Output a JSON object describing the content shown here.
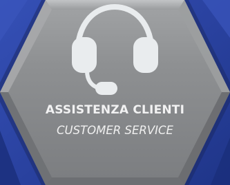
{
  "panel": {
    "icon": "headset-icon",
    "title": "ASSISTENZA CLIENTI",
    "subtitle": "CUSTOMER SERVICE"
  },
  "colors": {
    "background_blue": "#2a44a4",
    "hex_gray": "#8b8d8f",
    "icon_light": "#e9ecee",
    "text_light": "#f2f2f2"
  }
}
